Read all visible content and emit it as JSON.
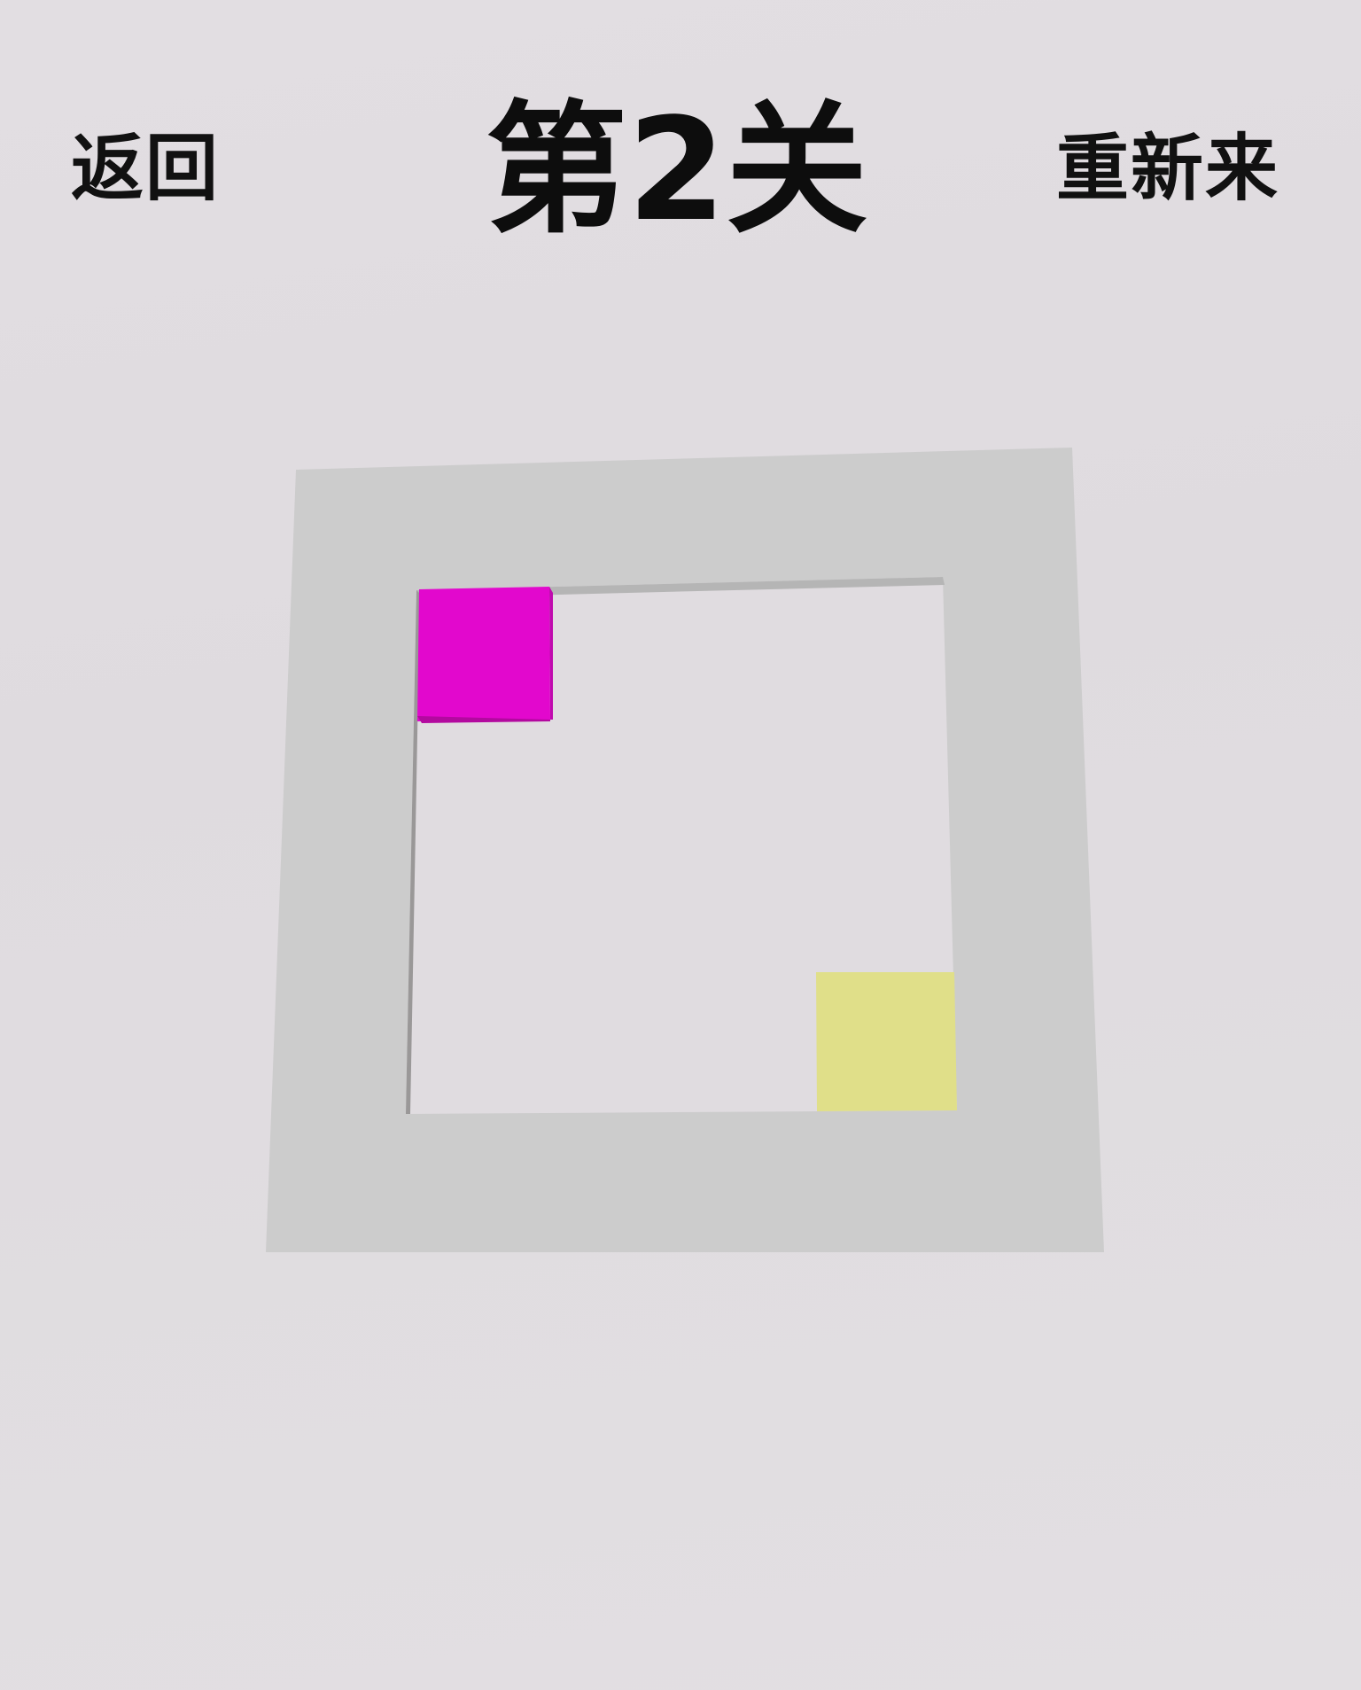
{
  "header": {
    "back_label": "返回",
    "title": "第2关",
    "restart_label": "重新来"
  },
  "game": {
    "board_color": "#cccccc",
    "field_color": "#e0dce0",
    "player_tile_color": "#e208cd",
    "goal_tile_color": "#e0df89"
  }
}
